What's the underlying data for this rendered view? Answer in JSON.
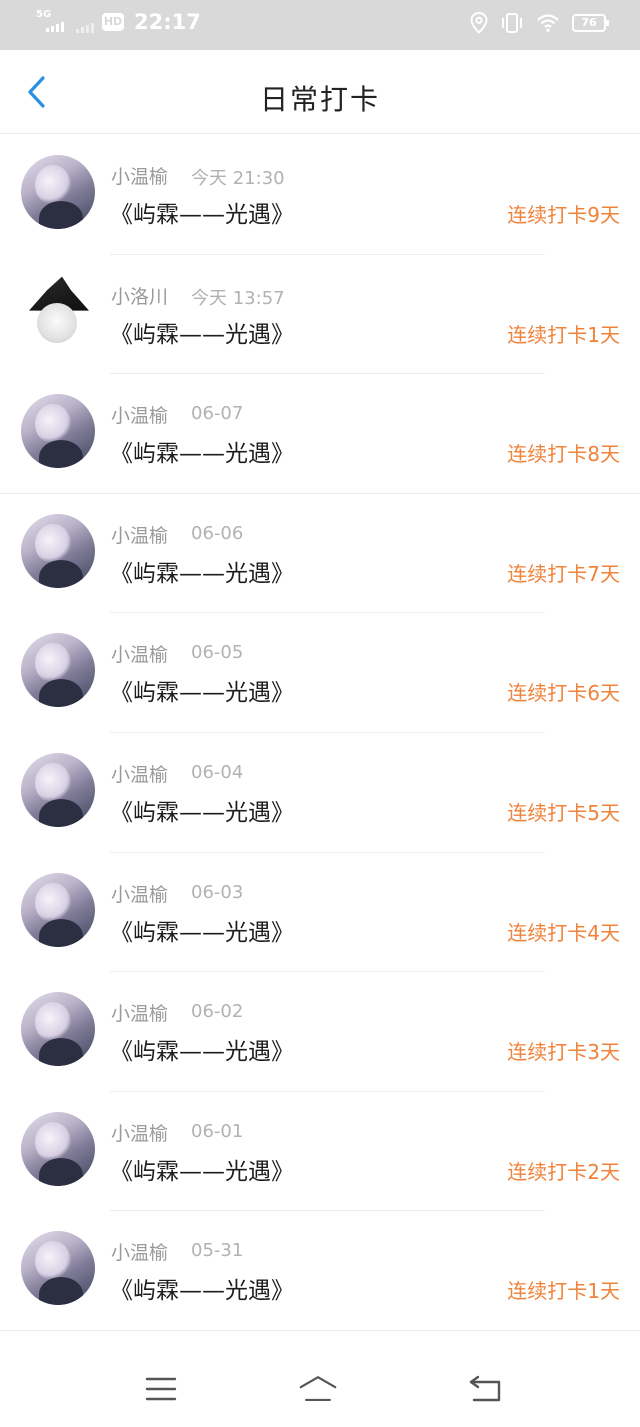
{
  "status_bar": {
    "network": "5G",
    "hd": "HD",
    "time": "22:17",
    "battery": "76"
  },
  "nav": {
    "title": "日常打卡"
  },
  "entries": [
    {
      "name": "小温榆",
      "time": "今天 21:30",
      "title": "《屿霖——光遇》",
      "streak": "连续打卡9天",
      "avatar": "avatar-silver-hair"
    },
    {
      "name": "小洛川",
      "time": "今天 13:57",
      "title": "《屿霖——光遇》",
      "streak": "连续打卡1天",
      "avatar": "avatar-witch-hat"
    },
    {
      "name": "小温榆",
      "time": "06-07",
      "title": "《屿霖——光遇》",
      "streak": "连续打卡8天",
      "avatar": "avatar-silver-hair"
    },
    {
      "name": "小温榆",
      "time": "06-06",
      "title": "《屿霖——光遇》",
      "streak": "连续打卡7天",
      "avatar": "avatar-silver-hair"
    },
    {
      "name": "小温榆",
      "time": "06-05",
      "title": "《屿霖——光遇》",
      "streak": "连续打卡6天",
      "avatar": "avatar-silver-hair"
    },
    {
      "name": "小温榆",
      "time": "06-04",
      "title": "《屿霖——光遇》",
      "streak": "连续打卡5天",
      "avatar": "avatar-silver-hair"
    },
    {
      "name": "小温榆",
      "time": "06-03",
      "title": "《屿霖——光遇》",
      "streak": "连续打卡4天",
      "avatar": "avatar-silver-hair"
    },
    {
      "name": "小温榆",
      "time": "06-02",
      "title": "《屿霖——光遇》",
      "streak": "连续打卡3天",
      "avatar": "avatar-silver-hair"
    },
    {
      "name": "小温榆",
      "time": "06-01",
      "title": "《屿霖——光遇》",
      "streak": "连续打卡2天",
      "avatar": "avatar-silver-hair"
    },
    {
      "name": "小温榆",
      "time": "05-31",
      "title": "《屿霖——光遇》",
      "streak": "连续打卡1天",
      "avatar": "avatar-silver-hair"
    }
  ],
  "colors": {
    "accent_blue": "#2b8fe6",
    "streak_orange": "#f0823a",
    "status_bar_bg": "#d9d9d9"
  }
}
